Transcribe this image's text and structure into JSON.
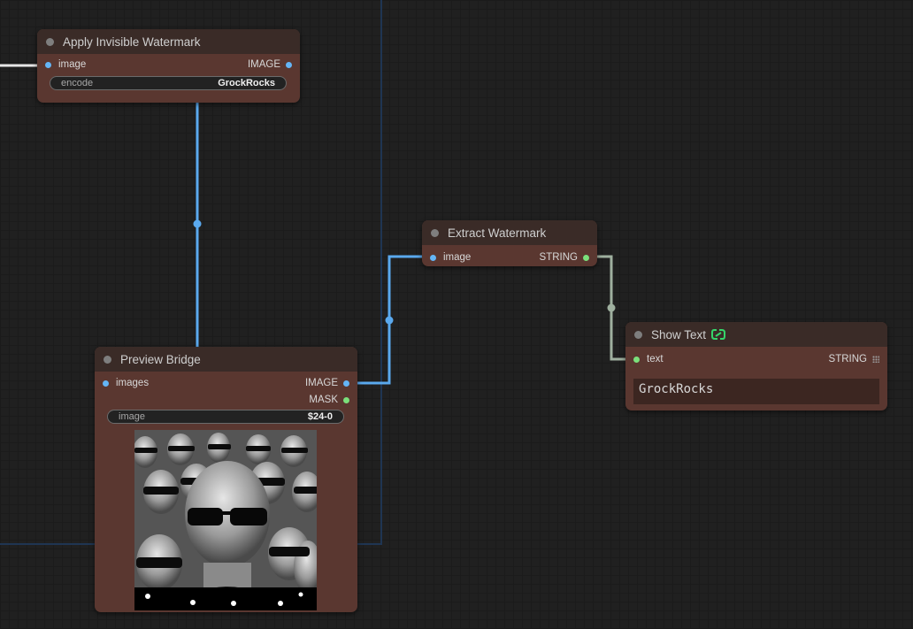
{
  "nodes": {
    "apply_watermark": {
      "title": "Apply Invisible Watermark",
      "input_label": "image",
      "output_label": "IMAGE",
      "widget_label": "encode",
      "widget_value": "GrockRocks"
    },
    "extract_watermark": {
      "title": "Extract Watermark",
      "input_label": "image",
      "output_label": "STRING"
    },
    "preview_bridge": {
      "title": "Preview Bridge",
      "input_label": "images",
      "output_image_label": "IMAGE",
      "output_mask_label": "MASK",
      "widget_label": "image",
      "widget_value": "$24-0"
    },
    "show_text": {
      "title": "Show Text",
      "input_label": "text",
      "output_label": "STRING",
      "text_value": "GrockRocks"
    }
  },
  "colors": {
    "node_body": "#5a3730",
    "node_title": "#3a2b27",
    "image_link": "#64b5f6",
    "string_link": "#9fb09f",
    "string_slot": "#7be07b",
    "group_border": "#1f3552"
  },
  "icons": {
    "collapse": "circle-dot",
    "show_text_badge": "link-icon",
    "slot_menu": "grip-icon"
  }
}
